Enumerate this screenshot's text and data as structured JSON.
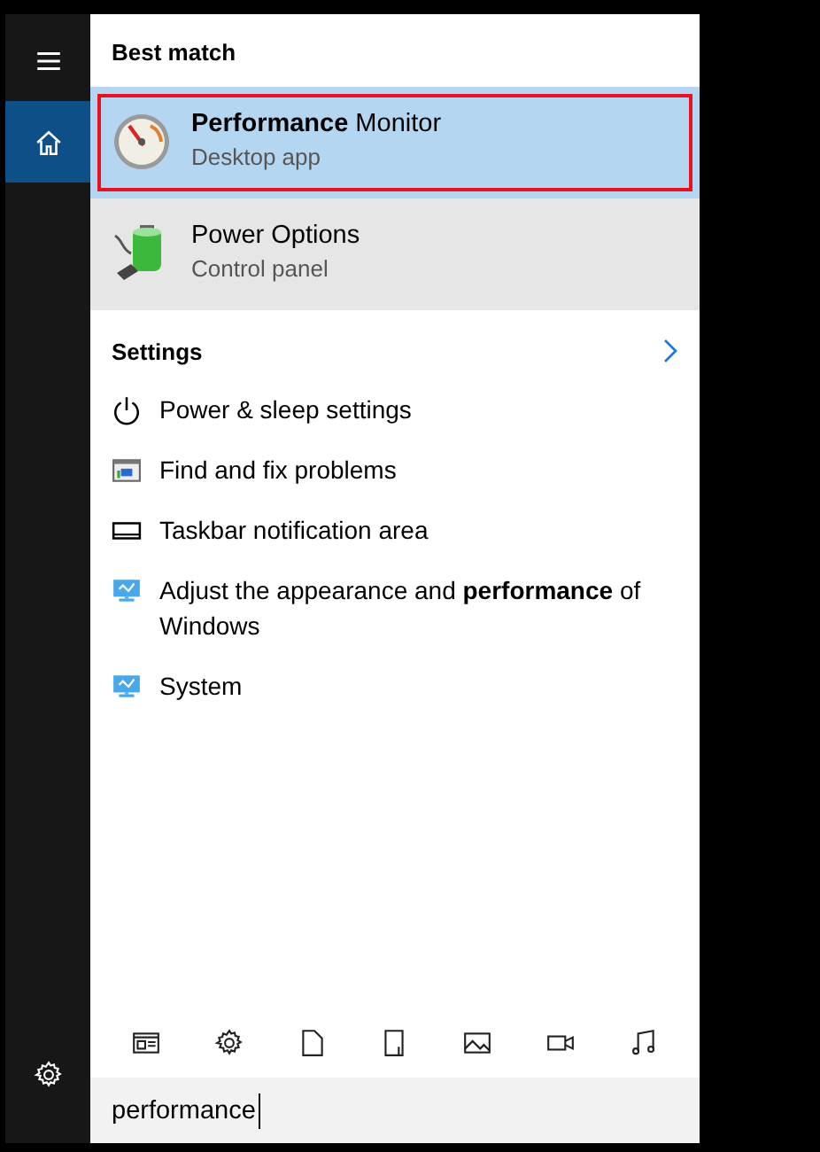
{
  "rail": {
    "items": [
      {
        "kind": "menu",
        "selected": false
      },
      {
        "kind": "home",
        "selected": true
      }
    ],
    "bottom": [
      {
        "kind": "settings",
        "selected": false
      }
    ]
  },
  "best_match": {
    "title": "Best match",
    "items": [
      {
        "kind": "perfmon",
        "name": "**Performance** Monitor",
        "subtitle": "Desktop app",
        "selected": true,
        "focused": true,
        "hovered": false
      },
      {
        "kind": "power",
        "name": "Power Options",
        "subtitle": "Control panel",
        "selected": false,
        "focused": false,
        "hovered": true
      }
    ]
  },
  "settings": {
    "title": "Settings",
    "items": [
      {
        "kind": "power-button",
        "text": "Power & sleep settings"
      },
      {
        "kind": "troubleshoot",
        "text": "Find and fix problems"
      },
      {
        "kind": "taskbar",
        "text": "Taskbar notification area"
      },
      {
        "kind": "monitor",
        "text": "Adjust the appearance and **performance** of Windows"
      },
      {
        "kind": "monitor",
        "text": "System"
      }
    ]
  },
  "filters": [
    {
      "kind": "apps"
    },
    {
      "kind": "settings"
    },
    {
      "kind": "document"
    },
    {
      "kind": "folder"
    },
    {
      "kind": "photo"
    },
    {
      "kind": "video"
    },
    {
      "kind": "music"
    }
  ],
  "search": {
    "value": "performance"
  }
}
